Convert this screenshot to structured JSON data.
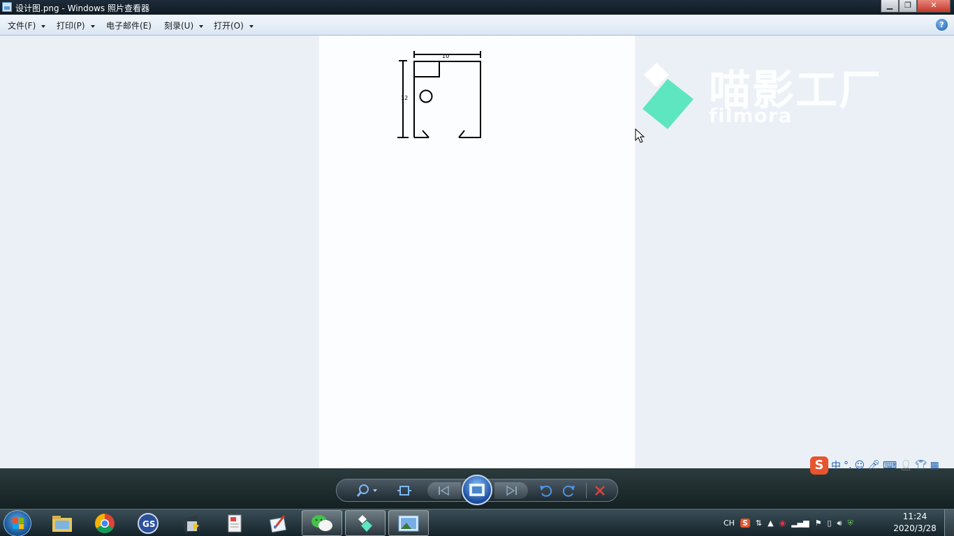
{
  "window": {
    "title": "设计图.png - Windows 照片查看器",
    "minimize": "▁",
    "maximize": "❐",
    "close": "✕"
  },
  "menu": {
    "file": "文件(F)",
    "print": "打印(P)",
    "email": "电子邮件(E)",
    "burn": "刻录(U)",
    "open": "打开(O)",
    "help": "?"
  },
  "drawing": {
    "width_label": "10",
    "height_label": "12"
  },
  "watermark": {
    "text": "喵影工厂",
    "sub": "filmora"
  },
  "ime": {
    "brand": "S",
    "mode": "中",
    "punct": "°,",
    "icons": [
      "smile-icon",
      "mic-icon",
      "keyboard-icon",
      "user-icon",
      "shirt-icon",
      "grid-icon"
    ]
  },
  "taskbar": {
    "apps": [
      "explorer",
      "chrome",
      "gs",
      "installer",
      "document",
      "paint",
      "wechat",
      "filmora",
      "photo-viewer"
    ]
  },
  "tray": {
    "lang": "CH",
    "time": "11:24",
    "date": "2020/3/28"
  },
  "colors": {
    "accent": "#5ee6c0",
    "viewer_bg": "#eaf0f6"
  }
}
